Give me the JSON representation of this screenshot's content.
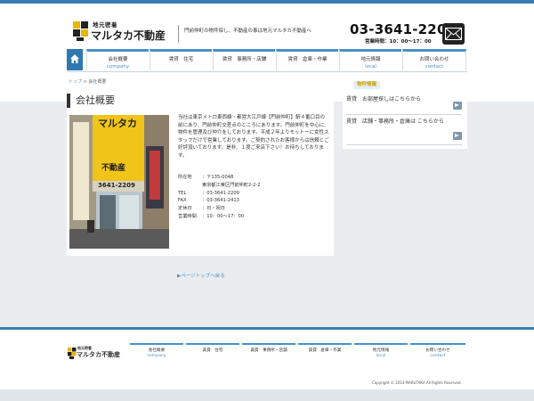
{
  "header": {
    "logo_small": "地元密着",
    "logo_big": "マルタカ不動産",
    "tagline": "門前仲町の物件探し、不動産の事は地元マルタカ不動産へ",
    "phone": "03-3641-2209",
    "hours": "営業時間：10：00〜17：00"
  },
  "nav": [
    {
      "jp": "会社概要",
      "en": "company"
    },
    {
      "jp": "賃貸　住宅",
      "en": ""
    },
    {
      "jp": "賃貸　事務所・店舗",
      "en": ""
    },
    {
      "jp": "賃貸　倉庫・作業",
      "en": ""
    },
    {
      "jp": "地元情報",
      "en": "local"
    },
    {
      "jp": "お問い合わせ",
      "en": "contact"
    }
  ],
  "breadcrumb": {
    "home": "トップ",
    "sep": " > ",
    "current": "会社概要"
  },
  "main": {
    "title": "会社概要",
    "description": "当社は東京メトロ東西線・都営大江戸線【門前仲町】駅４番口目の前にあり、門前仲町交差点のところにあります。門前仲町を中心に、物件を管理及び仲介をしております。平成２年よりモットーに女性スタッフだけで営業しております。ご契約されたお客様からは信頼とご好評頂いております。是非、１度ご来店下さい！お待ちしております。",
    "info": [
      {
        "k": "所在地",
        "v": "：〒135-0048"
      },
      {
        "k": "",
        "v": "東京都江東区門前仲町2-2-2"
      },
      {
        "k": "TEL",
        "v": "：03-3641-2209"
      },
      {
        "k": "FAX",
        "v": "：03-3641-2413"
      },
      {
        "k": "定休日",
        "v": "：日・祝日"
      },
      {
        "k": "営業時間",
        "v": "：10：00〜17：00"
      }
    ],
    "photo_sign_1": "マルタカ",
    "photo_sign_2": "不動産",
    "photo_sign_phone": "3641-2209"
  },
  "side": {
    "badge": "物件情報",
    "items": [
      {
        "label": "賃貸　お部屋探しはこちらから"
      },
      {
        "label": "賃貸　店舗・事務所・倉庫は こちらから"
      }
    ]
  },
  "pagetop": "▶ページトップへ戻る",
  "footer": {
    "logo_small": "地元密着",
    "logo_big": "マルタカ不動産",
    "copyright": "Copyright © 2014 MARUTAKA All Rights Reserved."
  },
  "colors": {
    "accent": "#3b7fb2",
    "link": "#4a90c8"
  }
}
